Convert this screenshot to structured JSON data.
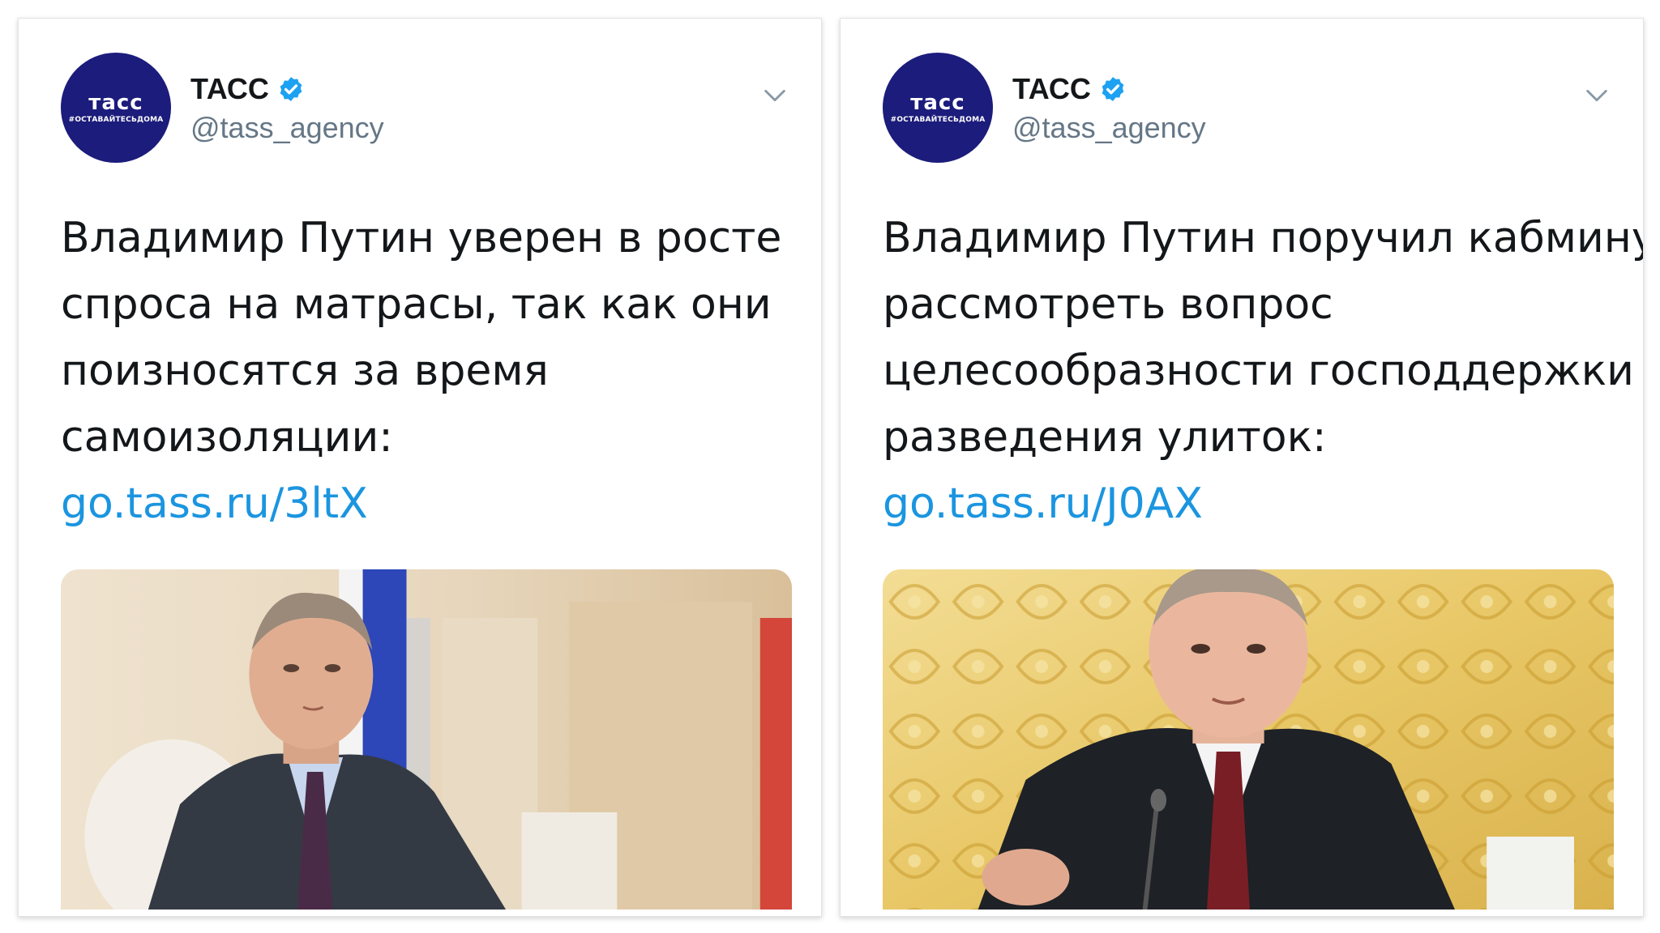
{
  "tweets": [
    {
      "author": {
        "name": "ТАСС",
        "handle": "@tass_agency",
        "avatar_logo": "тасс",
        "avatar_tag": "#ОСТАВАЙТЕСЬДОМА",
        "verified_icon": "verified-badge-icon"
      },
      "text_lines": [
        "Владимир Путин уверен в росте",
        "спроса на матрасы, так как они",
        "поизносятся за время",
        "самоизоляции:"
      ],
      "link": "go.tass.ru/3ltX",
      "menu_icon": "chevron-down-icon"
    },
    {
      "author": {
        "name": "ТАСС",
        "handle": "@tass_agency",
        "avatar_logo": "тасс",
        "avatar_tag": "#ОСТАВАЙТЕСЬДОМА",
        "verified_icon": "verified-badge-icon"
      },
      "text_lines": [
        "Владимир Путин поручил кабмину",
        "рассмотреть вопрос",
        "целесообразности господдержки",
        "разведения улиток:"
      ],
      "link": "go.tass.ru/J0AX",
      "menu_icon": "chevron-down-icon"
    }
  ],
  "colors": {
    "link": "#1b95e0",
    "avatar_bg": "#1c1c7c",
    "verified": "#1da1f2",
    "text": "#14171a",
    "handle": "#657786"
  }
}
